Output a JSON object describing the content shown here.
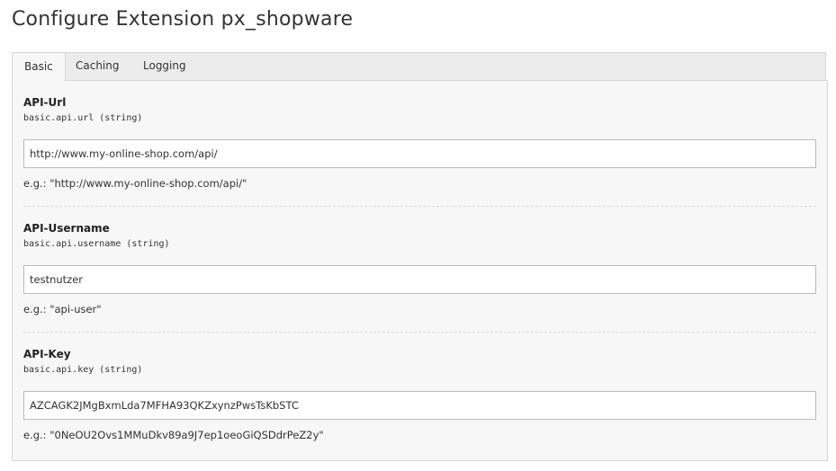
{
  "page": {
    "title": "Configure Extension px_shopware"
  },
  "tabs": [
    {
      "label": "Basic",
      "active": true
    },
    {
      "label": "Caching",
      "active": false
    },
    {
      "label": "Logging",
      "active": false
    }
  ],
  "fields": [
    {
      "label": "API-Url",
      "key": "basic.api.url (string)",
      "value": "http://www.my-online-shop.com/api/",
      "example": "e.g.: \"http://www.my-online-shop.com/api/\""
    },
    {
      "label": "API-Username",
      "key": "basic.api.username (string)",
      "value": "testnutzer",
      "example": "e.g.: \"api-user\""
    },
    {
      "label": "API-Key",
      "key": "basic.api.key (string)",
      "value": "AZCAGK2JMgBxmLda7MFHA93QKZxynzPwsTsKbSTC",
      "example": "e.g.: \"0NeOU2Ovs1MMuDkv89a9J7ep1oeoGiQSDdrPeZ2y\""
    }
  ]
}
